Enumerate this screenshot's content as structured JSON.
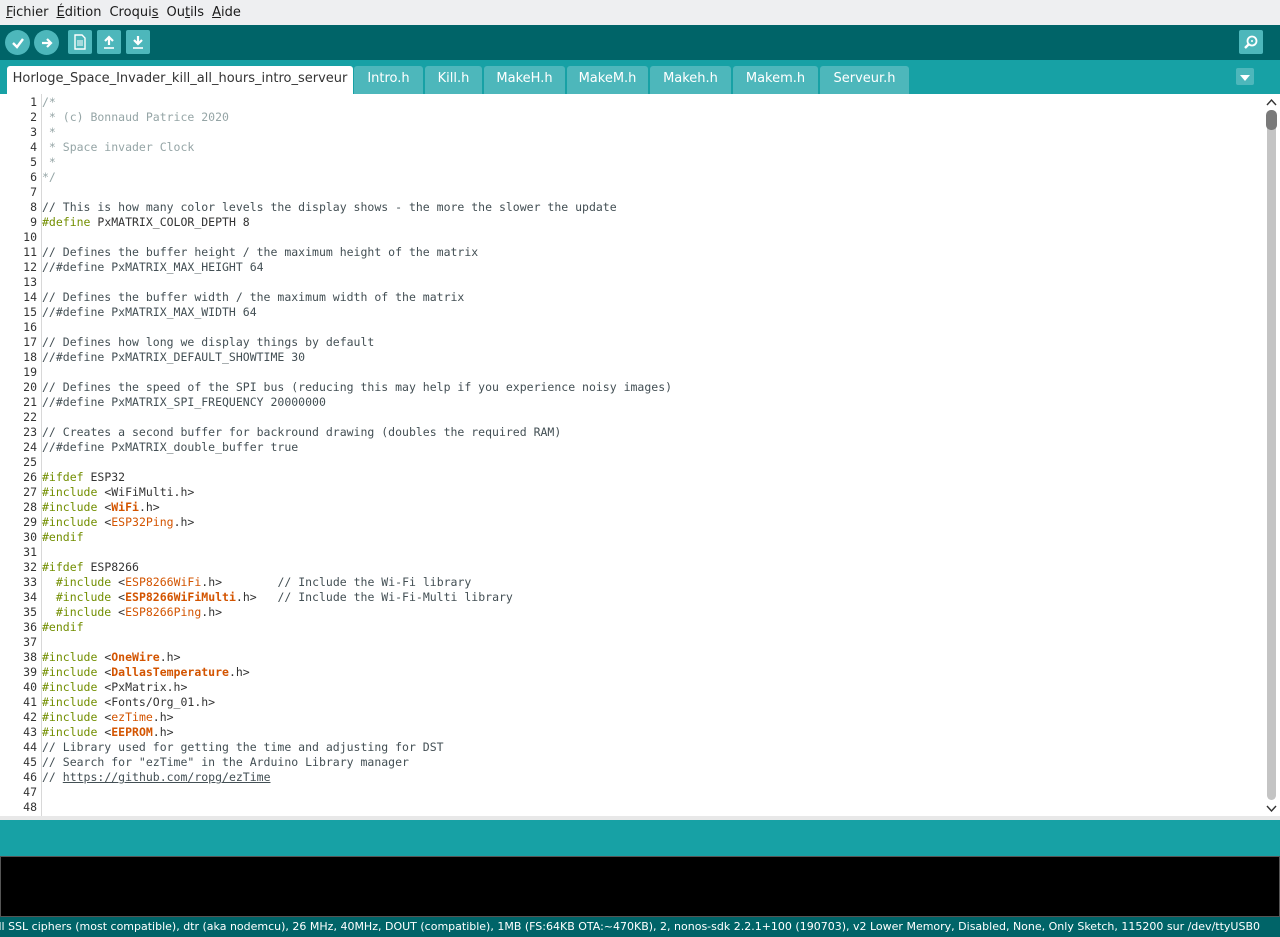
{
  "menu": {
    "items": [
      {
        "label": "Fichier",
        "mnemonic": "F"
      },
      {
        "label": "Édition",
        "mnemonic": "É"
      },
      {
        "label": "Croquis",
        "mnemonic": "s"
      },
      {
        "label": "Outils",
        "mnemonic": "t"
      },
      {
        "label": "Aide",
        "mnemonic": "A"
      }
    ]
  },
  "toolbar": {
    "verify_icon": "check-icon",
    "upload_icon": "arrow-right-icon",
    "new_icon": "new-file-icon",
    "open_icon": "open-arrow-up-icon",
    "save_icon": "save-arrow-down-icon",
    "serial_monitor_icon": "magnifier-icon"
  },
  "tabs": [
    {
      "label": "Horloge_Space_Invader_kill_all_hours_intro_serveur",
      "active": true
    },
    {
      "label": "Intro.h",
      "active": false
    },
    {
      "label": "Kill.h",
      "active": false
    },
    {
      "label": "MakeH.h",
      "active": false
    },
    {
      "label": "MakeM.h",
      "active": false
    },
    {
      "label": "Makeh.h",
      "active": false
    },
    {
      "label": "Makem.h",
      "active": false
    },
    {
      "label": "Serveur.h",
      "active": false
    }
  ],
  "editor": {
    "lines": [
      [
        {
          "t": "/*",
          "c": "doccomment"
        }
      ],
      [
        {
          "t": " * (c) Bonnaud Patrice 2020",
          "c": "doccomment"
        }
      ],
      [
        {
          "t": " *",
          "c": "doccomment"
        }
      ],
      [
        {
          "t": " * Space invader Clock",
          "c": "doccomment"
        }
      ],
      [
        {
          "t": " *",
          "c": "doccomment"
        }
      ],
      [
        {
          "t": "*/",
          "c": "doccomment"
        }
      ],
      [],
      [
        {
          "t": "// This is how many color levels the display shows - the more the slower the update",
          "c": "comment"
        }
      ],
      [
        {
          "t": "#define",
          "c": "kw"
        },
        {
          "t": " PxMATRIX_COLOR_DEPTH 8",
          "c": ""
        }
      ],
      [],
      [
        {
          "t": "// Defines the buffer height / the maximum height of the matrix",
          "c": "comment"
        }
      ],
      [
        {
          "t": "//#define PxMATRIX_MAX_HEIGHT 64",
          "c": "comment"
        }
      ],
      [],
      [
        {
          "t": "// Defines the buffer width / the maximum width of the matrix",
          "c": "comment"
        }
      ],
      [
        {
          "t": "//#define PxMATRIX_MAX_WIDTH 64",
          "c": "comment"
        }
      ],
      [],
      [
        {
          "t": "// Defines how long we display things by default",
          "c": "comment"
        }
      ],
      [
        {
          "t": "//#define PxMATRIX_DEFAULT_SHOWTIME 30",
          "c": "comment"
        }
      ],
      [],
      [
        {
          "t": "// Defines the speed of the SPI bus (reducing this may help if you experience noisy images)",
          "c": "comment"
        }
      ],
      [
        {
          "t": "//#define PxMATRIX_SPI_FREQUENCY 20000000",
          "c": "comment"
        }
      ],
      [],
      [
        {
          "t": "// Creates a second buffer for backround drawing (doubles the required RAM)",
          "c": "comment"
        }
      ],
      [
        {
          "t": "//#define PxMATRIX_double_buffer true",
          "c": "comment"
        }
      ],
      [],
      [
        {
          "t": "#ifdef",
          "c": "kw"
        },
        {
          "t": " ESP32",
          "c": ""
        }
      ],
      [
        {
          "t": "#include",
          "c": "kw"
        },
        {
          "t": " <WiFiMulti.h>",
          "c": ""
        }
      ],
      [
        {
          "t": "#include",
          "c": "kw"
        },
        {
          "t": " <",
          "c": ""
        },
        {
          "t": "WiFi",
          "c": "libb"
        },
        {
          "t": ".h>",
          "c": ""
        }
      ],
      [
        {
          "t": "#include",
          "c": "kw"
        },
        {
          "t": " <",
          "c": ""
        },
        {
          "t": "ESP32Ping",
          "c": "lib"
        },
        {
          "t": ".h>",
          "c": ""
        }
      ],
      [
        {
          "t": "#endif",
          "c": "kw"
        }
      ],
      [],
      [
        {
          "t": "#ifdef",
          "c": "kw"
        },
        {
          "t": " ESP8266",
          "c": ""
        }
      ],
      [
        {
          "t": "  #include",
          "c": "kw"
        },
        {
          "t": " <",
          "c": ""
        },
        {
          "t": "ESP8266WiFi",
          "c": "lib"
        },
        {
          "t": ".h>        ",
          "c": ""
        },
        {
          "t": "// Include the Wi-Fi library",
          "c": "comment"
        }
      ],
      [
        {
          "t": "  #include",
          "c": "kw"
        },
        {
          "t": " <",
          "c": ""
        },
        {
          "t": "ESP8266WiFiMulti",
          "c": "libb"
        },
        {
          "t": ".h>   ",
          "c": ""
        },
        {
          "t": "// Include the Wi-Fi-Multi library",
          "c": "comment"
        }
      ],
      [
        {
          "t": "  #include",
          "c": "kw"
        },
        {
          "t": " <",
          "c": ""
        },
        {
          "t": "ESP8266Ping",
          "c": "lib"
        },
        {
          "t": ".h>",
          "c": ""
        }
      ],
      [
        {
          "t": "#endif",
          "c": "kw"
        }
      ],
      [],
      [
        {
          "t": "#include",
          "c": "kw"
        },
        {
          "t": " <",
          "c": ""
        },
        {
          "t": "OneWire",
          "c": "libb"
        },
        {
          "t": ".h>",
          "c": ""
        }
      ],
      [
        {
          "t": "#include",
          "c": "kw"
        },
        {
          "t": " <",
          "c": ""
        },
        {
          "t": "DallasTemperature",
          "c": "libb"
        },
        {
          "t": ".h>",
          "c": ""
        }
      ],
      [
        {
          "t": "#include",
          "c": "kw"
        },
        {
          "t": " <PxMatrix.h>",
          "c": ""
        }
      ],
      [
        {
          "t": "#include",
          "c": "kw"
        },
        {
          "t": " <Fonts/Org_01.h>",
          "c": ""
        }
      ],
      [
        {
          "t": "#include",
          "c": "kw"
        },
        {
          "t": " <",
          "c": ""
        },
        {
          "t": "ezTime",
          "c": "lib"
        },
        {
          "t": ".h>",
          "c": ""
        }
      ],
      [
        {
          "t": "#include",
          "c": "kw"
        },
        {
          "t": " <",
          "c": ""
        },
        {
          "t": "EEPROM",
          "c": "libb"
        },
        {
          "t": ".h>",
          "c": ""
        }
      ],
      [
        {
          "t": "// Library used for getting the time and adjusting for DST",
          "c": "comment"
        }
      ],
      [
        {
          "t": "// Search for \"ezTime\" in the Arduino Library manager",
          "c": "comment"
        }
      ],
      [
        {
          "t": "// ",
          "c": "comment"
        },
        {
          "t": "https://github.com/ropg/ezTime",
          "c": "link"
        }
      ],
      [],
      []
    ]
  },
  "footer": {
    "status": "ady (new can return nullptr), All SSL ciphers (most compatible), dtr (aka nodemcu), 26 MHz, 40MHz, DOUT (compatible), 1MB (FS:64KB OTA:~470KB), 2, nonos-sdk 2.2.1+100 (190703), v2 Lower Memory, Disabled, None, Only Sketch, 115200 sur /dev/ttyUSB0"
  },
  "colors": {
    "toolbar": "#006468",
    "tabbar": "#17a1a5",
    "tab_inactive": "#4db7bb",
    "keyword": "#728e00",
    "library": "#d35400",
    "comment": "#434f54",
    "doc_comment": "#95a5a6"
  }
}
